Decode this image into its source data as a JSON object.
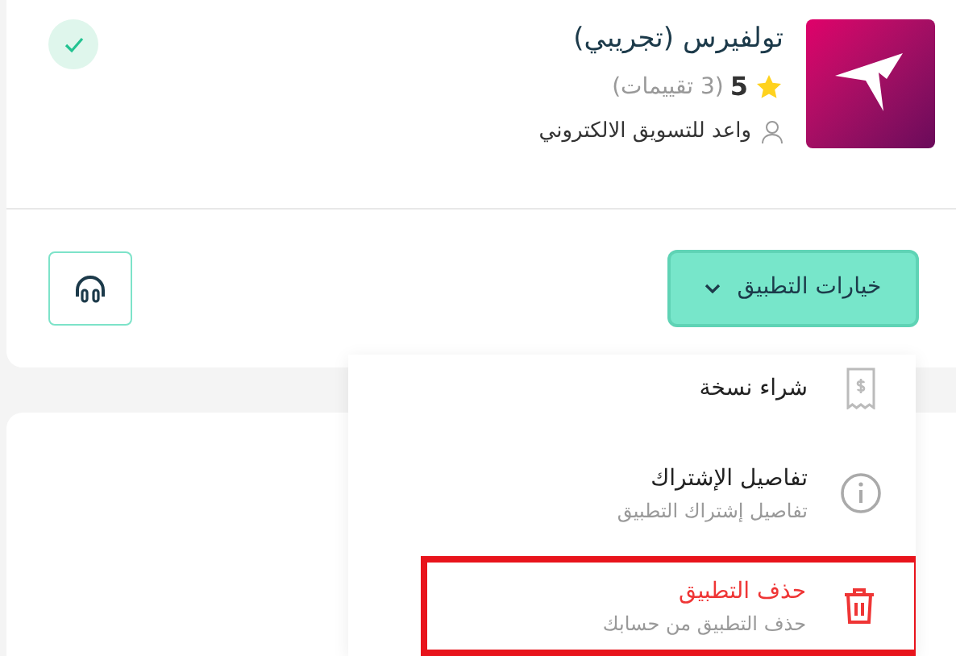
{
  "app": {
    "name": "تولفيرس (تجريبي)",
    "rating": "5",
    "reviews": "(3 تقييمات)",
    "vendor": "واعد للتسويق الالكتروني",
    "verified": true
  },
  "options_button": {
    "label": "خيارات التطبيق",
    "expanded": true
  },
  "menu": [
    {
      "title": "شراء نسخة",
      "danger": false,
      "highlighted": false
    },
    {
      "title": "تفاصيل الإشتراك",
      "subtitle": "تفاصيل إشتراك التطبيق",
      "danger": false,
      "highlighted": false
    },
    {
      "title": "حذف التطبيق",
      "subtitle": "حذف التطبيق من حسابك",
      "danger": true,
      "highlighted": true
    }
  ]
}
